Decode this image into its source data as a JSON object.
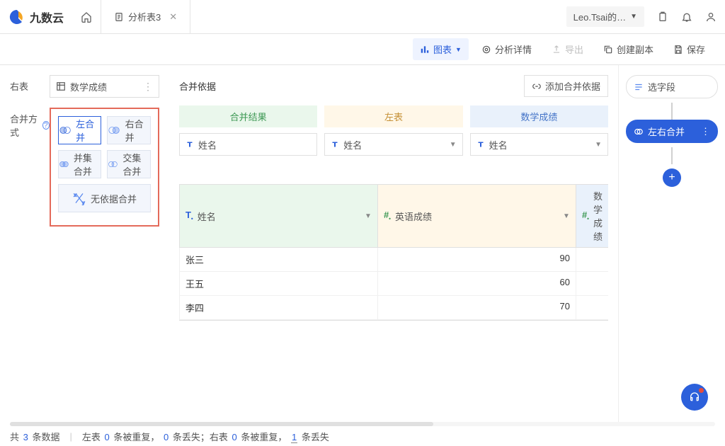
{
  "brand": {
    "name": "九数云"
  },
  "tab": {
    "title": "分析表3"
  },
  "user": {
    "label": "Leo.Tsai的…"
  },
  "toolbar": {
    "chart": "图表",
    "detail": "分析详情",
    "export": "导出",
    "copy": "创建副本",
    "save": "保存"
  },
  "left": {
    "right_table_label": "右表",
    "right_table_value": "数学成绩",
    "merge_method_label": "合并方式",
    "btn_left": "左合并",
    "btn_right": "右合并",
    "btn_union": "并集合并",
    "btn_intersect": "交集合并",
    "btn_nobasis": "无依据合并"
  },
  "middle": {
    "basis_label": "合并依据",
    "add_basis": "添加合并依据",
    "labels": {
      "result": "合并结果",
      "left": "左表",
      "right": "数学成绩"
    },
    "fields": {
      "result": "姓名",
      "left": "姓名",
      "right": "姓名"
    },
    "columns": {
      "c0": {
        "label": "姓名",
        "type": "T"
      },
      "c1": {
        "label": "英语成绩",
        "type": "#"
      },
      "c2": {
        "label": "数学成绩",
        "type": "#"
      }
    },
    "rows": [
      {
        "name": "张三",
        "eng": "90",
        "math": ""
      },
      {
        "name": "王五",
        "eng": "60",
        "math": ""
      },
      {
        "name": "李四",
        "eng": "70",
        "math": ""
      }
    ]
  },
  "steps": {
    "select_field": "选字段",
    "merge_lr": "左右合并"
  },
  "status": {
    "p1a": "共",
    "p1b": "条数据",
    "n_total": "3",
    "p2a": "左表",
    "p2b": "条被重复，",
    "p2c": "条丢失；右表",
    "p2d": "条被重复，",
    "p2e": "条丢失",
    "n_l_dup": "0",
    "n_l_lost": "0",
    "n_r_dup": "0",
    "n_r_lost": "1"
  }
}
